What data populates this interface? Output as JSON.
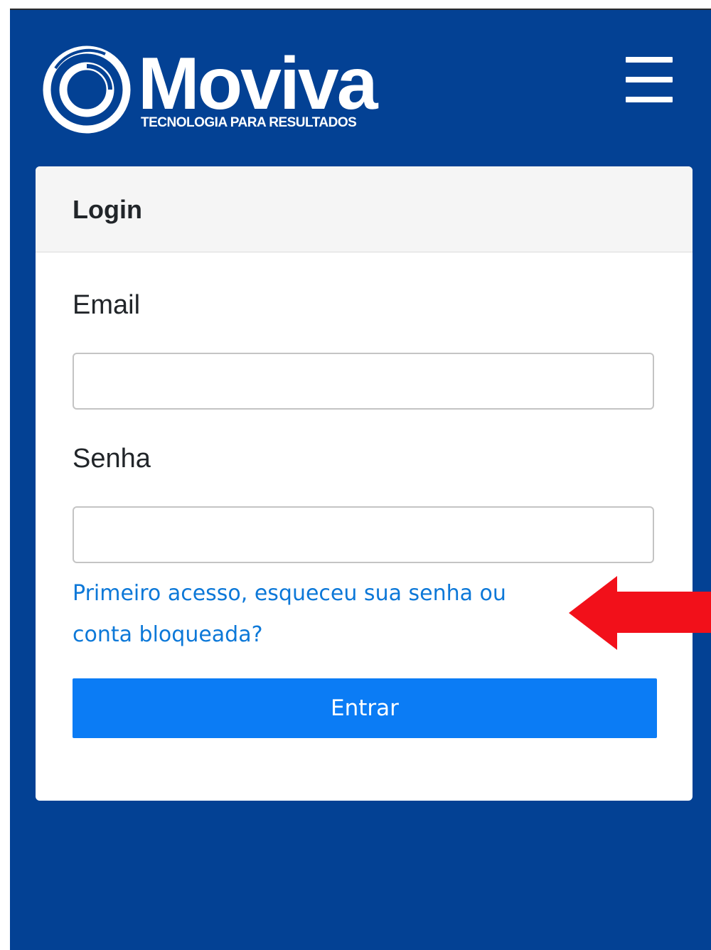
{
  "brand": {
    "name": "Moviva",
    "tagline": "TECNOLOGIA PARA RESULTADOS"
  },
  "header": {
    "menu_icon": "hamburger-menu-icon"
  },
  "login_card": {
    "title": "Login",
    "email_label": "Email",
    "email_value": "",
    "password_label": "Senha",
    "password_value": "",
    "help_link": "Primeiro acesso, esqueceu sua senha ou conta bloqueada?",
    "submit_label": "Entrar"
  },
  "colors": {
    "background": "#034194",
    "card_header": "#f5f5f5",
    "link": "#0c78d8",
    "button": "#0b7cf5",
    "annotation_arrow": "#f2101a"
  },
  "annotation": {
    "icon": "arrow-left-icon"
  }
}
